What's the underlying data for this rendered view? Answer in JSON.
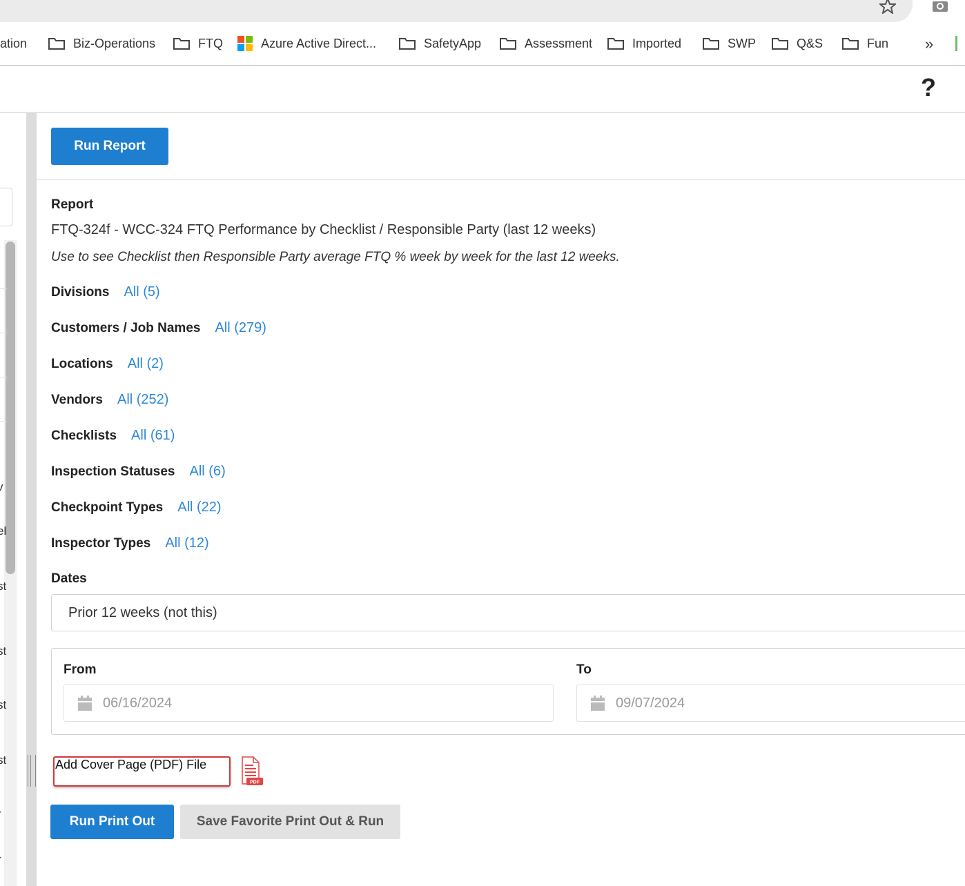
{
  "browser": {
    "bookmarks": [
      {
        "label": "ation",
        "icon": "none"
      },
      {
        "label": "Biz-Operations",
        "icon": "folder-icon"
      },
      {
        "label": "FTQ",
        "icon": "folder-icon"
      },
      {
        "label": "Azure Active Direct...",
        "icon": "microsoft-logo-icon"
      },
      {
        "label": "SafetyApp",
        "icon": "folder-icon"
      },
      {
        "label": "Assessment",
        "icon": "folder-icon"
      },
      {
        "label": "Imported",
        "icon": "folder-icon"
      },
      {
        "label": "SWP",
        "icon": "folder-icon"
      },
      {
        "label": "Q&S",
        "icon": "folder-icon"
      },
      {
        "label": "Fun",
        "icon": "folder-icon"
      }
    ],
    "more_label": "»"
  },
  "header": {
    "help_label": "?"
  },
  "sidebar": {
    "fragments": [
      "v",
      "el",
      "st",
      "st",
      "st",
      "st",
      "r",
      "r"
    ]
  },
  "main": {
    "run_report_label": "Run Report",
    "report_label": "Report",
    "report_title": "FTQ-324f - WCC-324 FTQ Performance by Checklist / Responsible Party (last 12 weeks)",
    "report_description": "Use to see Checklist then Responsible Party average FTQ % week by week for the last 12 weeks.",
    "filters": [
      {
        "label": "Divisions",
        "value": "All (5)"
      },
      {
        "label": "Customers / Job Names",
        "value": "All (279)"
      },
      {
        "label": "Locations",
        "value": "All (2)"
      },
      {
        "label": "Vendors",
        "value": "All (252)"
      },
      {
        "label": "Checklists",
        "value": "All (61)"
      },
      {
        "label": "Inspection Statuses",
        "value": "All (6)"
      },
      {
        "label": "Checkpoint Types",
        "value": "All (22)"
      },
      {
        "label": "Inspector Types",
        "value": "All (12)"
      }
    ],
    "dates": {
      "label": "Dates",
      "selected": "Prior 12 weeks (not this)",
      "from_label": "From",
      "from_value": "06/16/2024",
      "to_label": "To",
      "to_value": "09/07/2024"
    },
    "cover_page_label": "Add Cover Page (PDF) File",
    "pdf_badge": "PDF",
    "run_printout_label": "Run Print Out",
    "save_favorite_label": "Save Favorite Print Out & Run"
  },
  "colors": {
    "primary": "#1e7fd1",
    "link": "#2d87d8",
    "danger": "#cc3b3b",
    "secondary_bg": "#e2e2e2"
  }
}
